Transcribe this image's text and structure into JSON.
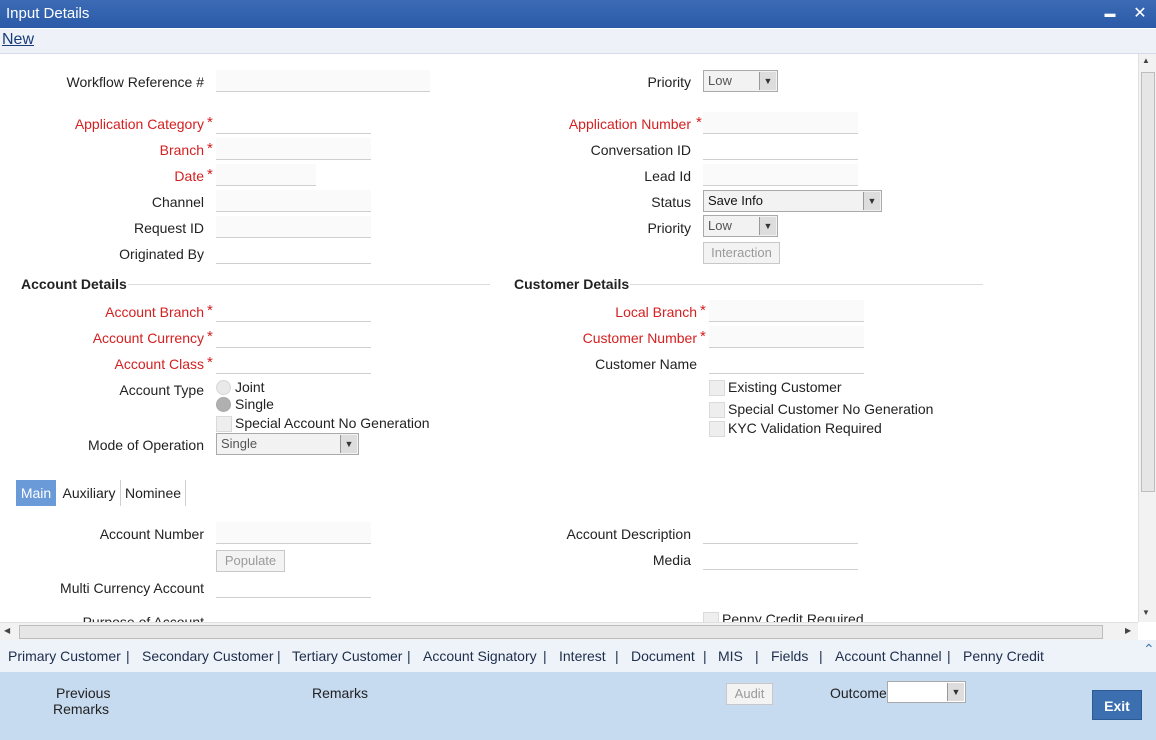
{
  "window": {
    "title": "Input Details",
    "minimize_glyph": "▬",
    "close_glyph": "✕"
  },
  "menu": {
    "new_label": "New"
  },
  "form": {
    "workflow_reference_label": "Workflow Reference #",
    "priority_top_label": "Priority",
    "priority_top_value": "Low",
    "application_category_label": "Application Category",
    "application_number_label": "Application Number",
    "branch_label": "Branch",
    "conversation_id_label": "Conversation ID",
    "date_label": "Date",
    "lead_id_label": "Lead Id",
    "channel_label": "Channel",
    "status_label": "Status",
    "status_value": "Save Info",
    "request_id_label": "Request ID",
    "priority_label": "Priority",
    "priority_value": "Low",
    "originated_by_label": "Originated By",
    "interaction_button": "Interaction",
    "required_mark": "*"
  },
  "account_details": {
    "heading": "Account Details",
    "account_branch_label": "Account Branch",
    "account_currency_label": "Account Currency",
    "account_class_label": "Account Class",
    "account_type_label": "Account Type",
    "joint_label": "Joint",
    "single_label": "Single",
    "special_account_label": "Special Account No Generation",
    "mode_of_operation_label": "Mode of Operation",
    "mode_of_operation_value": "Single"
  },
  "customer_details": {
    "heading": "Customer Details",
    "local_branch_label": "Local Branch",
    "customer_number_label": "Customer Number",
    "customer_name_label": "Customer Name",
    "existing_customer_label": "Existing Customer",
    "special_customer_label": "Special Customer No Generation",
    "kyc_label": "KYC Validation Required"
  },
  "tabs": [
    {
      "label": "Main"
    },
    {
      "label": "Auxiliary"
    },
    {
      "label": "Nominee"
    }
  ],
  "main_tab": {
    "account_number_label": "Account Number",
    "populate_button": "Populate",
    "multi_currency_label": "Multi Currency Account",
    "purpose_label": "Purpose of Account",
    "account_description_label": "Account Description",
    "media_label": "Media",
    "penny_credit_label": "Penny Credit Required"
  },
  "bottom_nav": [
    "Primary Customer",
    "Secondary Customer",
    "Tertiary Customer",
    "Account Signatory",
    "Interest",
    "Document",
    "MIS",
    "Fields",
    "Account Channel",
    "Penny Credit"
  ],
  "nav_separator": "|",
  "footer": {
    "previous_remarks_line1": "Previous",
    "previous_remarks_line2": "Remarks",
    "remarks_label": "Remarks",
    "audit_button": "Audit",
    "outcome_label": "Outcome",
    "exit_button": "Exit"
  },
  "colors": {
    "title_bar": "#2a5aa8",
    "required": "#d42020",
    "tab_active": "#6a9ad8",
    "footer_bg": "#c6daf0",
    "exit_btn": "#3b6fb0"
  },
  "icons": {
    "scroll_up": "▲",
    "scroll_down": "▼",
    "scroll_left": "◀",
    "scroll_right": "▶",
    "collapse": "⌃",
    "dropdown": "▼"
  }
}
